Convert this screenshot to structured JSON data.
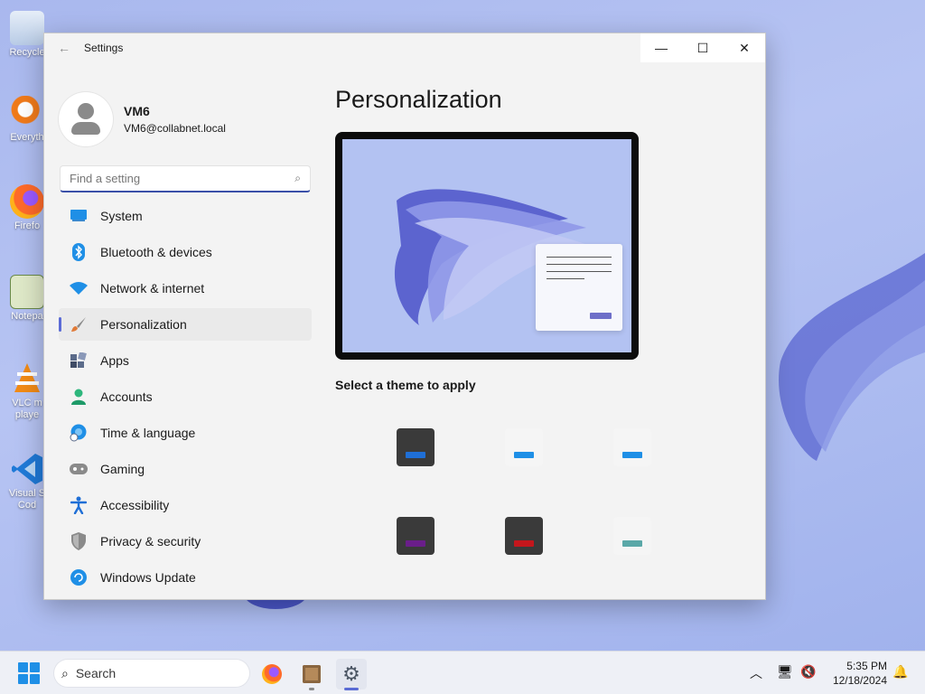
{
  "desktop": {
    "icons": [
      {
        "label": "Recycle",
        "icon": "recycle-bin-icon"
      },
      {
        "label": "Everyth",
        "icon": "everything-search-icon"
      },
      {
        "label": "Firefo",
        "icon": "firefox-icon"
      },
      {
        "label": "Notepa",
        "icon": "notepad-icon"
      },
      {
        "label": "VLC m",
        "label2": "playe",
        "icon": "vlc-icon"
      },
      {
        "label": "Visual S",
        "label2": "Cod",
        "icon": "vscode-icon"
      }
    ]
  },
  "window": {
    "title": "Settings",
    "controls": {
      "minimize": "—",
      "maximize": "☐",
      "close": "✕"
    }
  },
  "profile": {
    "name": "VM6",
    "email": "VM6@collabnet.local"
  },
  "search": {
    "placeholder": "Find a setting",
    "value": ""
  },
  "nav": {
    "items": [
      {
        "label": "System",
        "icon": "system-icon",
        "color": "#1f8fe6"
      },
      {
        "label": "Bluetooth & devices",
        "icon": "bluetooth-icon",
        "color": "#1f8fe6"
      },
      {
        "label": "Network & internet",
        "icon": "wifi-icon",
        "color": "#1f8fe6"
      },
      {
        "label": "Personalization",
        "icon": "brush-icon",
        "color": "#e07b39",
        "active": true
      },
      {
        "label": "Apps",
        "icon": "apps-icon",
        "color": "#5b6b8a"
      },
      {
        "label": "Accounts",
        "icon": "accounts-icon",
        "color": "#2db67c"
      },
      {
        "label": "Time & language",
        "icon": "globe-clock-icon",
        "color": "#1f8fe6"
      },
      {
        "label": "Gaming",
        "icon": "gamepad-icon",
        "color": "#7a7a7a"
      },
      {
        "label": "Accessibility",
        "icon": "accessibility-icon",
        "color": "#1f6fd6"
      },
      {
        "label": "Privacy & security",
        "icon": "shield-icon",
        "color": "#7a7a7a"
      },
      {
        "label": "Windows Update",
        "icon": "update-icon",
        "color": "#1f8fe6"
      }
    ]
  },
  "main": {
    "title": "Personalization",
    "theme_label": "Select a theme to apply",
    "themes": [
      {
        "name": "dark-blue",
        "style": "dark",
        "accent": "#1f6fd6"
      },
      {
        "name": "light-blue",
        "style": "light",
        "accent": "#1f8fe6"
      },
      {
        "name": "light-blue-2",
        "style": "light",
        "accent": "#1f8fe6"
      },
      {
        "name": "dark-purple",
        "style": "dark",
        "accent": "#6a1e8a"
      },
      {
        "name": "dark-red",
        "style": "dark",
        "accent": "#c4161c"
      },
      {
        "name": "light-teal",
        "style": "light",
        "accent": "#5aa8a8"
      }
    ]
  },
  "taskbar": {
    "search_label": "Search",
    "time": "5:35 PM",
    "date": "12/18/2024"
  }
}
